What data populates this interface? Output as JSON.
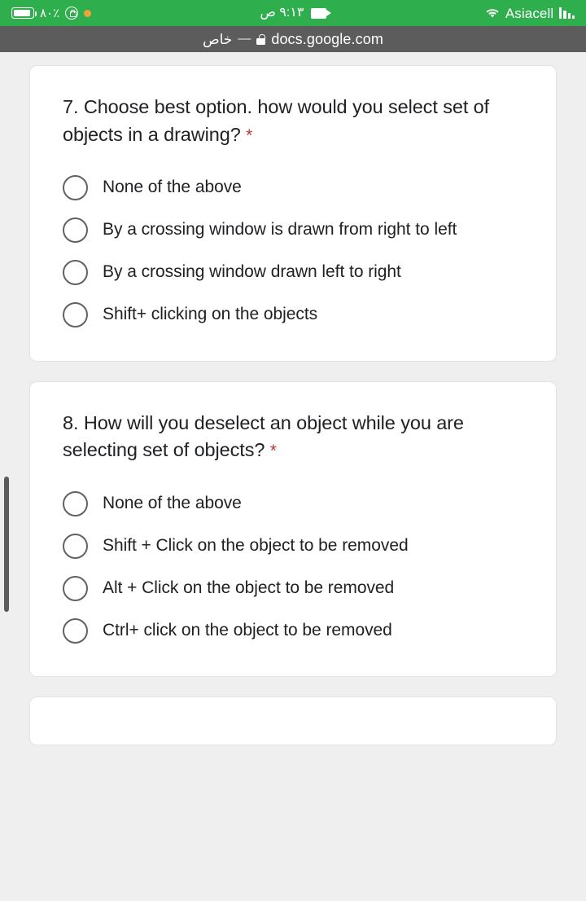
{
  "status_bar": {
    "battery_percent": "٪٨٠",
    "battery_icon": "battery-icon",
    "rotation_lock_icon": "rotation-lock-icon",
    "recording_dot_icon": "orange-recording-dot",
    "time": "٩:١٣ ص",
    "screen_record_icon": "video-camera-icon",
    "wifi_icon": "wifi-icon",
    "carrier": "Asiacell",
    "signal_icon": "signal-bars-icon",
    "background_color": "#2fae4e"
  },
  "url_bar": {
    "private_label": "خاص",
    "separator": "—",
    "lock_icon": "lock-icon",
    "host": "docs.google.com",
    "background_color": "#5c5c5c"
  },
  "form": {
    "questions": [
      {
        "text": "7. Choose best option. how would you select set of objects in a drawing?",
        "required_marker": "*",
        "options": [
          {
            "label": "None of the above",
            "selected": false
          },
          {
            "label": "By a crossing window is drawn from right to left",
            "selected": false
          },
          {
            "label": "By a crossing window drawn left to right",
            "selected": false
          },
          {
            "label": "Shift+ clicking on the objects",
            "selected": false
          }
        ]
      },
      {
        "text": "8. How will you deselect an object while you are selecting set of objects?",
        "required_marker": "*",
        "options": [
          {
            "label": "None of the above",
            "selected": false
          },
          {
            "label": "Shift + Click on the object to be removed",
            "selected": false
          },
          {
            "label": "Alt + Click on the object to be removed",
            "selected": false
          },
          {
            "label": "Ctrl+ click on the object to be removed",
            "selected": false
          }
        ]
      }
    ]
  },
  "scrollbar": {
    "name": "page-scrollbar",
    "color": "#5b5b5b"
  },
  "colors": {
    "page_background": "#efefef",
    "card_background": "#ffffff",
    "text_primary": "#202124",
    "required_red": "#b03a36",
    "radio_border": "#5f6368"
  }
}
